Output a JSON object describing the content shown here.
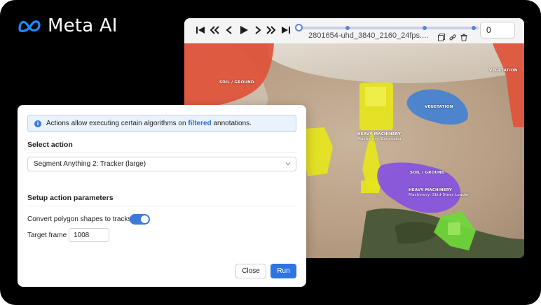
{
  "brand": {
    "name": "Meta AI",
    "color": "#0a7cff"
  },
  "player": {
    "filename": "2801654-uhd_3840_2160_24fps....",
    "frame_value": "0",
    "progress_fraction": 0.0,
    "controls": [
      "skip-to-start-icon",
      "fast-backward-icon",
      "step-backward-icon",
      "play-icon",
      "step-forward-icon",
      "fast-forward-icon",
      "skip-to-end-icon"
    ],
    "file_actions": [
      "copy-icon",
      "link-icon",
      "delete-icon"
    ]
  },
  "scene": {
    "labels": [
      {
        "id": "soil-left",
        "text": "SOIL / GROUND"
      },
      {
        "id": "vegetation-right",
        "text": "VEGETATION"
      },
      {
        "id": "vegetation-mid",
        "text": "VEGETATION"
      },
      {
        "id": "machinery-1",
        "text": "HEAVY MACHINERY"
      },
      {
        "id": "machinery-1-sub",
        "text": "Machinery: Excavator"
      },
      {
        "id": "soil-mid",
        "text": "SOIL / GROUND"
      },
      {
        "id": "machinery-2",
        "text": "HEAVY MACHINERY"
      },
      {
        "id": "machinery-2-sub",
        "text": "Machinery: Skid-Steer Loader"
      }
    ],
    "colors": {
      "soil": "#e0533a",
      "vegetation": "#3d7fd6",
      "excavator": "#e6e51c",
      "soil_purple": "#8552e0",
      "loader": "#6fd83a"
    }
  },
  "dialog": {
    "info_text_before": "Actions allow executing certain algorithms on ",
    "info_link": "filtered",
    "info_text_after": " annotations.",
    "select_action_title": "Select action",
    "selected_action": "Segment Anything 2: Tracker (large)",
    "setup_title": "Setup action parameters",
    "convert_label": "Convert polygon shapes to tracks",
    "convert_enabled": true,
    "target_frame_label": "Target frame",
    "target_frame_value": "1008",
    "close_label": "Close",
    "run_label": "Run",
    "accent": "#2f74df"
  }
}
